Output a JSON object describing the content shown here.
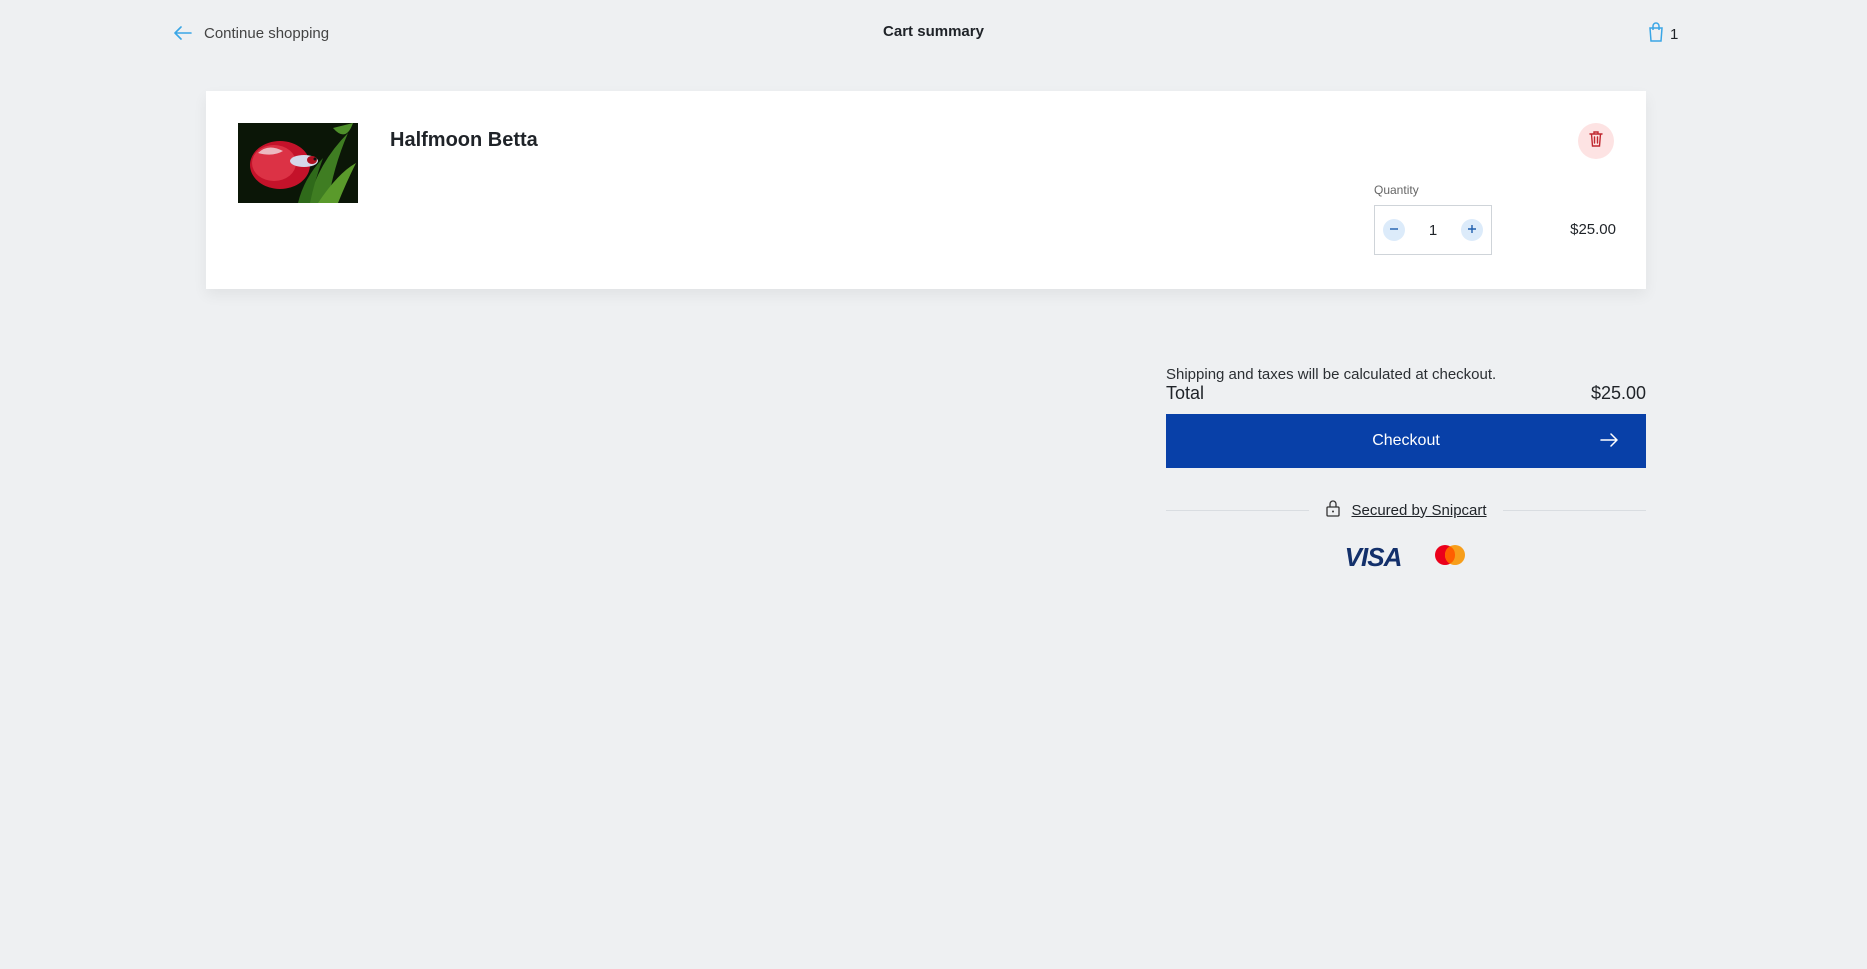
{
  "header": {
    "continue_label": "Continue shopping",
    "title": "Cart summary",
    "cart_count": "1",
    "accent_color": "#3aa6e6"
  },
  "cart": {
    "item": {
      "name": "Halfmoon Betta",
      "quantity_label": "Quantity",
      "quantity": "1",
      "price": "$25.00",
      "image_icon": "betta-fish-photo"
    }
  },
  "summary": {
    "shipping_note": "Shipping and taxes will be calculated at checkout.",
    "total_label": "Total",
    "total_value": "$25.00",
    "checkout_label": "Checkout",
    "secured_label": "Secured by Snipcart",
    "checkout_color": "#0840a8",
    "payment_methods": [
      "VISA",
      "Mastercard"
    ]
  }
}
